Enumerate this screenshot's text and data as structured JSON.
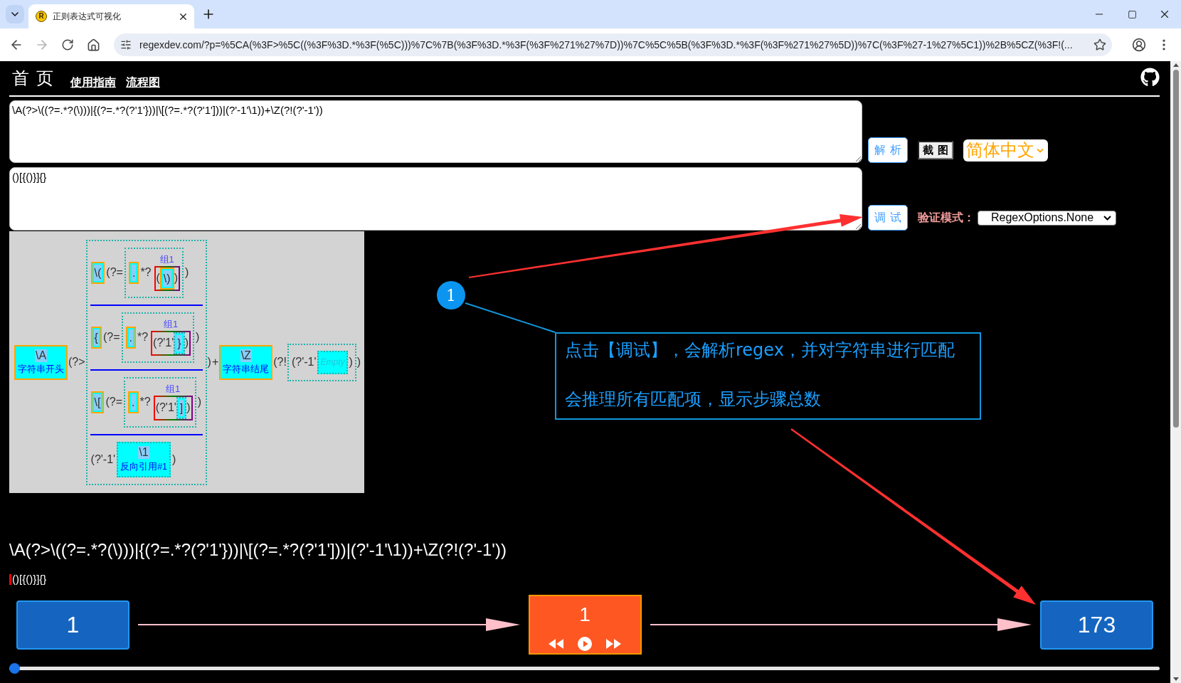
{
  "browser": {
    "tab": {
      "favicon_letter": "R",
      "title": "正则表达式可视化"
    },
    "back": {
      "disabled": false
    },
    "forward": {
      "disabled": true
    },
    "address": "regexdev.com/?p=%5CA(%3F>%5C((%3F%3D.*%3F(%5C)))%7C%7B(%3F%3D.*%3F(%3F%271%27%7D))%7C%5C%5B(%3F%3D.*%3F(%3F%271%27%5D))%7C(%3F%27-1%27%5C1))%2B%5CZ(%3F!(..."
  },
  "nav": {
    "title": "首页",
    "links": [
      {
        "label": "使用指南"
      },
      {
        "label": "流程图"
      }
    ]
  },
  "editor": {
    "pattern": "\\A(?>\\((?=.*?(\\)))|{(?=.*?(?'1'}))|\\[(?=.*?(?'1']))|(?'-1'\\1))+\\Z(?!(?'-1'))",
    "test_string": "()[{()}]{}",
    "parse_button": "解 析",
    "screenshot_button": "截 图",
    "language_select": "简体中文",
    "debug_button": "调 试",
    "mode_label": "验证模式：",
    "mode_select": "RegexOptions.None"
  },
  "diagram": {
    "children": [
      {
        "kind": "anchor",
        "text": "\\A",
        "caption": "字符串开头"
      },
      {
        "kind": "token",
        "text": "(?>"
      },
      {
        "kind": "alternation",
        "branches": [
          {
            "children": [
              {
                "kind": "char",
                "text": "\\("
              },
              {
                "kind": "token",
                "text": "(?="
              },
              {
                "kind": "lookaround",
                "children": [
                  {
                    "kind": "char",
                    "text": "."
                  },
                  {
                    "kind": "token",
                    "text": "*?"
                  },
                  {
                    "kind": "group",
                    "label": "组1",
                    "children": [
                      {
                        "kind": "token",
                        "text": "("
                      },
                      {
                        "kind": "char",
                        "text": "\\)"
                      },
                      {
                        "kind": "token",
                        "text": ")"
                      }
                    ]
                  }
                ]
              },
              {
                "kind": "token",
                "text": ")"
              }
            ]
          },
          {
            "children": [
              {
                "kind": "char",
                "text": "{"
              },
              {
                "kind": "token",
                "text": "(?="
              },
              {
                "kind": "lookaround",
                "children": [
                  {
                    "kind": "char",
                    "text": "."
                  },
                  {
                    "kind": "token",
                    "text": "*?"
                  },
                  {
                    "kind": "group",
                    "label": "组1",
                    "children": [
                      {
                        "kind": "token",
                        "text": "(?'1'"
                      },
                      {
                        "kind": "dotchar",
                        "text": "}"
                      },
                      {
                        "kind": "token",
                        "text": ")"
                      }
                    ]
                  }
                ]
              },
              {
                "kind": "token",
                "text": ")"
              }
            ]
          },
          {
            "children": [
              {
                "kind": "char",
                "text": "\\["
              },
              {
                "kind": "token",
                "text": "(?="
              },
              {
                "kind": "lookaround",
                "children": [
                  {
                    "kind": "char",
                    "text": "."
                  },
                  {
                    "kind": "token",
                    "text": "*?"
                  },
                  {
                    "kind": "group",
                    "label": "组1",
                    "children": [
                      {
                        "kind": "token",
                        "text": "(?'1'"
                      },
                      {
                        "kind": "dotchar",
                        "text": "]"
                      },
                      {
                        "kind": "token",
                        "text": ")"
                      }
                    ]
                  }
                ]
              },
              {
                "kind": "token",
                "text": ")"
              }
            ]
          },
          {
            "children": [
              {
                "kind": "token",
                "text": "(?'-1'"
              },
              {
                "kind": "backref",
                "text": "\\1",
                "caption": "反向引用#1"
              },
              {
                "kind": "token",
                "text": ")"
              }
            ]
          }
        ]
      },
      {
        "kind": "token",
        "text": ")"
      },
      {
        "kind": "token",
        "text": "+"
      },
      {
        "kind": "anchor",
        "text": "\\Z",
        "caption": "字符串结尾"
      },
      {
        "kind": "token",
        "text": "(?!"
      },
      {
        "kind": "lookaround",
        "children": [
          {
            "kind": "token",
            "text": "(?'-1'"
          },
          {
            "kind": "empty",
            "text": "Empty"
          },
          {
            "kind": "token",
            "text": ")"
          }
        ]
      },
      {
        "kind": "token",
        "text": ")"
      }
    ]
  },
  "trace": {
    "pattern": "\\A(?>\\((?=.*?(\\)))|{(?=.*?(?'1'}))|\\[(?=.*?(?'1']))|(?'-1'\\1))+\\Z(?!(?'-1'))",
    "test_string": "()[{()}]{}",
    "steps": {
      "first": "1",
      "current": "1",
      "total": "173"
    },
    "slider": {
      "level": 0
    }
  },
  "callout": {
    "number": "1",
    "lines": [
      "点击【调试】，会解析regex，并对字符串进行匹配",
      "会推理所有匹配项，显示步骤总数"
    ]
  }
}
